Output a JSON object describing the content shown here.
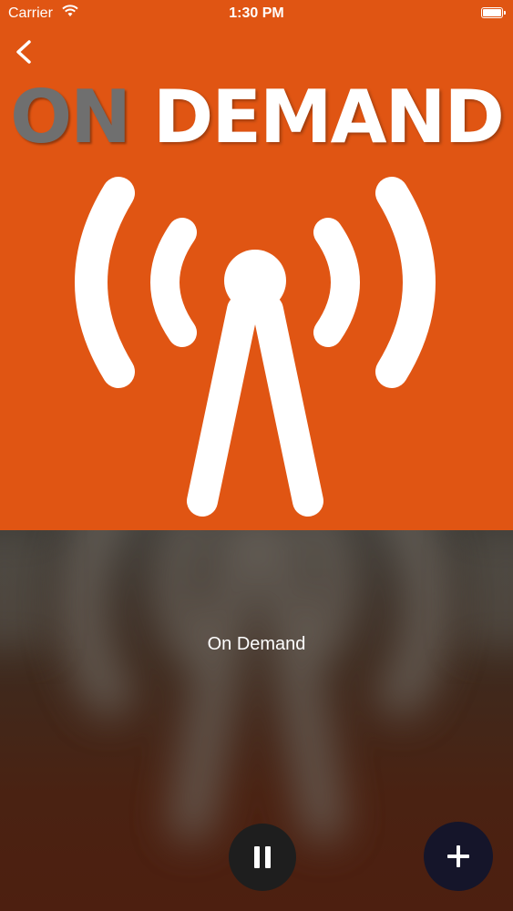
{
  "status_bar": {
    "carrier": "Carrier",
    "time": "1:30 PM",
    "icons": [
      "wifi-icon",
      "battery-icon"
    ]
  },
  "artwork": {
    "title_part1": "ON",
    "title_part2": " DEMAND",
    "background_color": "#e05513",
    "icon": "radio-tower-icon"
  },
  "navigation": {
    "back_icon": "chevron-left-icon"
  },
  "player": {
    "track_title": "On Demand",
    "pause_icon": "pause-icon",
    "add_icon": "plus-icon"
  }
}
